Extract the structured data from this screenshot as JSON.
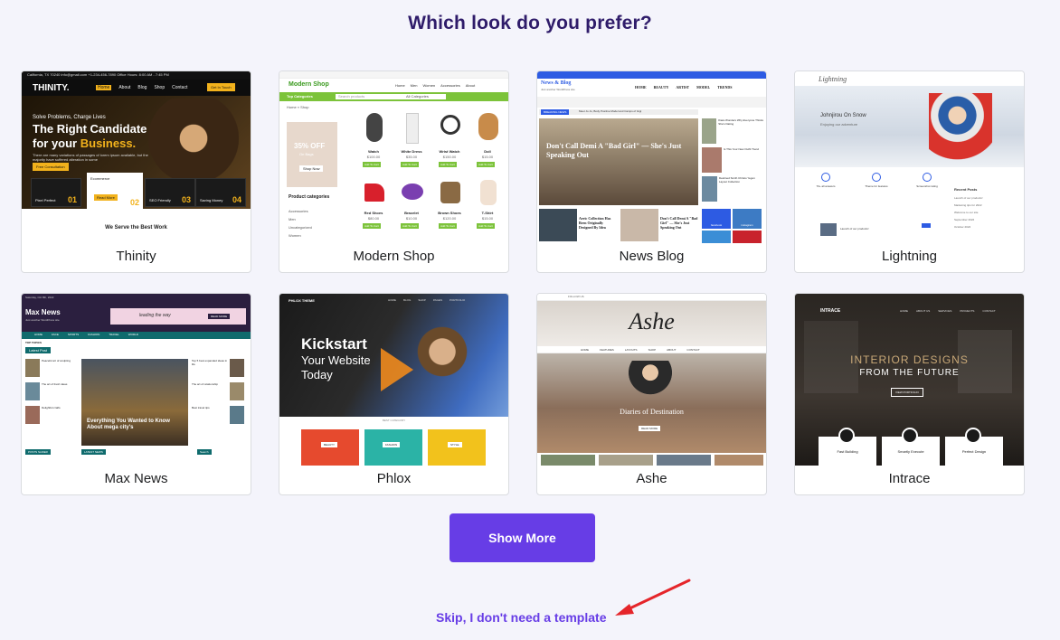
{
  "page": {
    "title": "Which look do you prefer?"
  },
  "templates": [
    {
      "name": "Thinity",
      "preview": {
        "topbar": "California, TX 70240   info@gmail.com   +1-234-456-7890   Office Hours: 8:00 AM - 7:45 PM",
        "logo": "THINITY.",
        "nav": [
          "Home",
          "About",
          "Blog",
          "Shop",
          "Contact"
        ],
        "cta": "Get In Touch",
        "kicker": "Solve Problems, Charge Lives",
        "headline_1": "The Right Candidate",
        "headline_2": "for your",
        "headline_accent": "Business.",
        "body": "There are many variations of passages of lorem ipsum available, but the majority have suffered alteration in some",
        "button": "Free Consultation",
        "features": [
          {
            "label": "Pixel Perfect",
            "num": "01"
          },
          {
            "label": "Ecommerce",
            "num": "02"
          },
          {
            "label": "SEO Friendly",
            "num": "03"
          },
          {
            "label": "Saving Money",
            "num": "04"
          }
        ],
        "read_more": "Read More",
        "serve": "We Serve the Best Work"
      }
    },
    {
      "name": "Modern Shop",
      "preview": {
        "logo": "Modern Shop",
        "nav": [
          "Home",
          "Men",
          "Women",
          "Accessories",
          "About"
        ],
        "categories": "Top Categories",
        "search_placeholder": "Search products",
        "all_categories": "All Categories",
        "breadcrumb": "Home » Shop",
        "promo": "35% OFF",
        "promo_sub": "On Bags",
        "promo_btn": "Shop Now",
        "sidebar_title": "Product categories",
        "sidebar_items": [
          "Accessories",
          "Men",
          "Uncategorized",
          "Women"
        ],
        "products": [
          {
            "title": "Watch",
            "price": "$100.00"
          },
          {
            "title": "White Dress",
            "price": "$35.00"
          },
          {
            "title": "Wrist Watch",
            "price": "$150.00"
          },
          {
            "title": "Doll",
            "price": "$15.00"
          },
          {
            "title": "Red Shoes",
            "price": "$80.00"
          },
          {
            "title": "Bracelet",
            "price": "$10.00"
          },
          {
            "title": "Brown Shoes",
            "price": "$120.00"
          },
          {
            "title": "T-Shirt",
            "price": "$15.00"
          }
        ],
        "add_to_cart": "Add To Cart"
      }
    },
    {
      "name": "News Blog",
      "preview": {
        "logo": "News & Blog",
        "tagline": "Just another WordPress site",
        "nav": [
          "HOME",
          "BEAUTY",
          "ARTIST",
          "MODEL",
          "TRENDS"
        ],
        "breaking": "BREAKING NEWS",
        "breaking_text": "Meet Jo Jo, Body Positive Model and Camps of Gigi",
        "headline": "Don't Call Demi A \"Bad Girl\" — She's Just Speaking Out",
        "side_items": [
          "Kiara Wonders Why Everyone Thinks She's Dating",
          "Is This Your New Outfit Trend",
          "Destined Smith Christo Yegon Layout Collection"
        ],
        "bottom_1": "Aeric Collection Has Been Originally Designed By Idea",
        "bottom_2": "Don't Call Demi A \"Bad Girl\" — She's Just Speaking Out",
        "social": [
          "facebook",
          "instagram"
        ]
      }
    },
    {
      "name": "Lightning",
      "preview": {
        "logo": "Lightning",
        "hero_title": "Johnjirou On Snow",
        "hero_sub": "Enjoying our adventure",
        "features": [
          "70+ all answers",
          "Theme for features",
          "Screenshot rating"
        ],
        "sidebar_title": "Recent Posts",
        "sidebar_items": [
          "Launch of our products!",
          "Marketing tips for 2022",
          "Welcome to our site",
          "September 2022",
          "October 2022"
        ],
        "post_title": "Launch of our products!"
      }
    },
    {
      "name": "Max News",
      "preview": {
        "date": "Saturday, Oct 8th, 2022",
        "logo": "Max News",
        "tagline": "Just another WordPress site",
        "banner_text": "leading the way",
        "banner_btn": "READ MORE",
        "nav": [
          "HOME",
          "FACE",
          "SPORTS",
          "FASHION",
          "TRAVEL",
          "WORLD"
        ],
        "ticker_label": "TOP TOPICS",
        "latest": "Latest Post",
        "latest_items": [
          "Peaceful art of sculpting",
          "The art of fresh ideas",
          "Delightful crafts"
        ],
        "feature_headline": "Everything You Wanted to Know About mega city's",
        "right_items": [
          "Top 5 best expanded ideas in life",
          "The art of relationship",
          "Best travel tips"
        ],
        "sections": [
          "POSTS SLIDER",
          "LATEST NEWS",
          "Search"
        ]
      }
    },
    {
      "name": "Phlox",
      "preview": {
        "logo": "PHLOX THEME",
        "nav": [
          "HOME",
          "BLOG",
          "SHOP",
          "PAGES",
          "PORTFOLIO"
        ],
        "headline_1": "Kickstart",
        "headline_2": "Your Website",
        "headline_3": "Today",
        "section_label": "BEST CATEGORY",
        "tiles": [
          "BEAUTY",
          "FASHION",
          "STYLE"
        ]
      }
    },
    {
      "name": "Ashe",
      "preview": {
        "top_links": "FOLLOW US",
        "logo": "Ashe",
        "nav": [
          "HOME",
          "FEATURES",
          "LAYOUTS",
          "SHOP",
          "ABOUT",
          "CONTACT"
        ],
        "hero_title": "Diaries of Destination",
        "hero_btn": "READ MORE"
      }
    },
    {
      "name": "Intrace",
      "preview": {
        "logo": "INTRACE",
        "nav": [
          "HOME",
          "ABOUT US",
          "SERVICES",
          "PROJECTS",
          "CONTACT"
        ],
        "headline_1": "INTERIOR DESIGNS",
        "headline_2": "FROM THE FUTURE",
        "btn": "VIEW PORTFOLIO",
        "features": [
          "Fast Building",
          "Smartly Execute",
          "Perfect Design"
        ]
      }
    }
  ],
  "actions": {
    "show_more": "Show More",
    "skip": "Skip, I don't need a template"
  },
  "colors": {
    "accent": "#673de6",
    "title": "#2f1c6a",
    "background": "#f4f4fb",
    "arrow": "#e5252a"
  }
}
